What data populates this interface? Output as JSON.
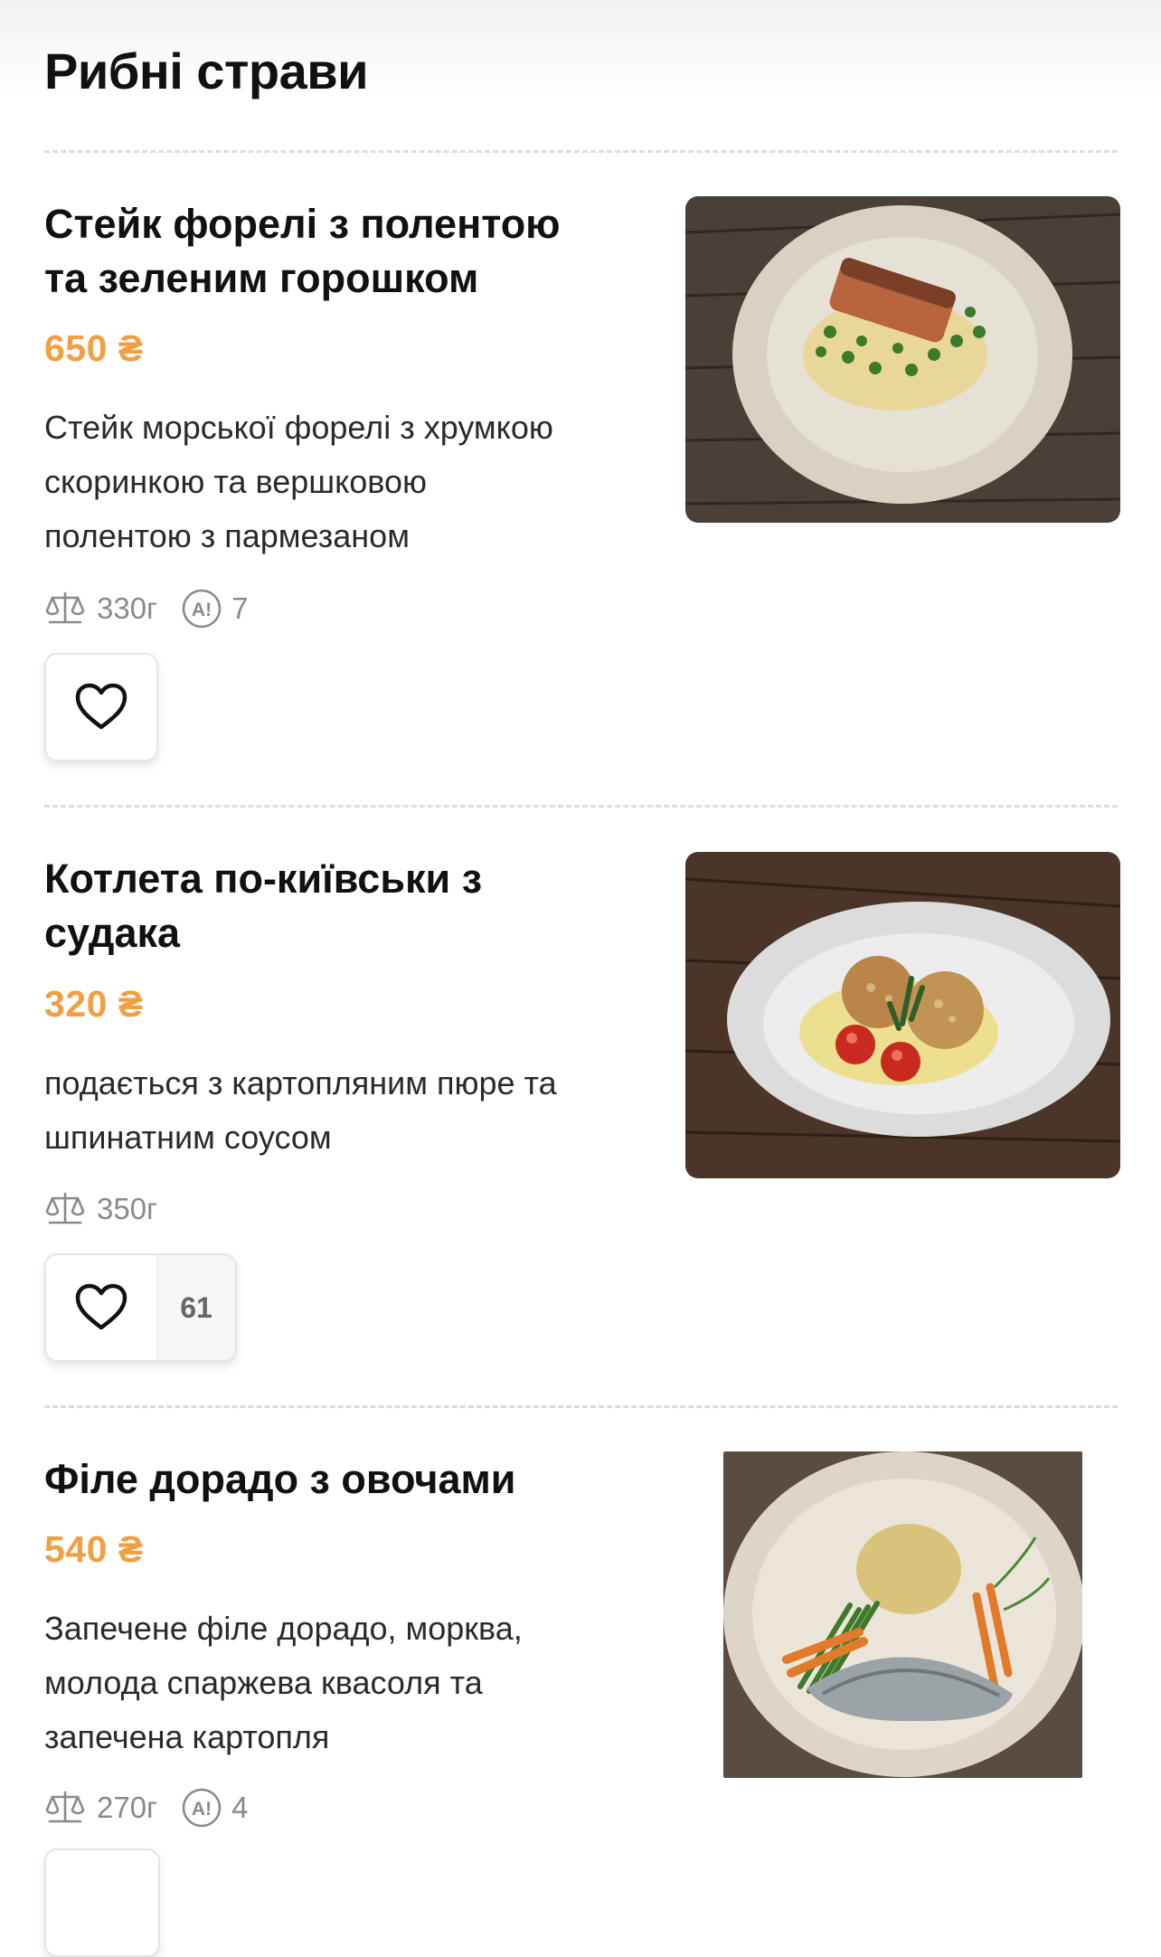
{
  "section": {
    "title": "Рибні страви"
  },
  "dishes": [
    {
      "name_line1": "Стейк форелі з полентою",
      "name_line2": "та зеленим горошком",
      "price": "650 ₴",
      "desc_line1": "Стейк морської форелі з хрумкою",
      "desc_line2": "скоринкою та вершковою",
      "desc_line3": "полентою з пармезаном",
      "weight": "330г",
      "allergens": "7",
      "favorites": "",
      "photo_icon": "trout-steak-photo"
    },
    {
      "name_line1": "Котлета по-київськи з",
      "name_line2": "судака",
      "price": "320 ₴",
      "desc_line1": "подається з картопляним пюре та",
      "desc_line2": "шпинатним соусом",
      "weight": "350г",
      "favorites": "61",
      "photo_icon": "chicken-kiev-pike-perch-photo"
    },
    {
      "name_line1": "Філе дорадо з овочами",
      "price": "540 ₴",
      "desc_line1": "Запечене філе дорадо, морква,",
      "desc_line2": "молода спаржева квасоля та",
      "desc_line3": "запечена картопля",
      "weight": "270г",
      "allergens": "4",
      "photo_icon": "dorado-fillet-photo"
    }
  ],
  "colors": {
    "price": "#f0a043",
    "divider": "#dcdcdc",
    "text": "#111111",
    "meta": "#8a8a8a"
  },
  "icons": {
    "weight": "scale-icon",
    "allergen": "allergen-icon",
    "favorite": "heart-icon"
  }
}
